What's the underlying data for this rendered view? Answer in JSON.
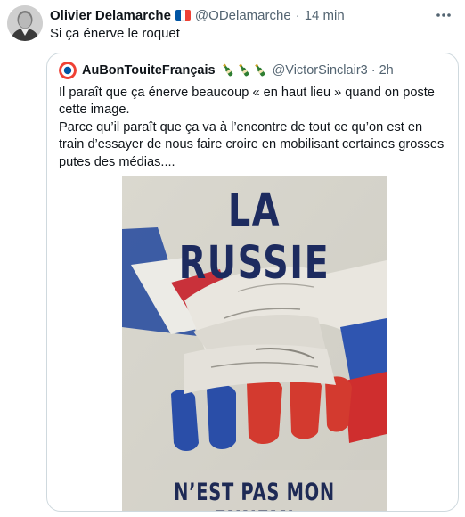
{
  "tweet": {
    "author_name": "Olivier Delamarche",
    "handle": "@ODelamarche",
    "separator": "·",
    "time": "14 min",
    "text": "Si ça énerve le roquet",
    "more_icon": "more-horizontal-icon"
  },
  "quoted_tweet": {
    "author_name": "AuBonTouiteFrançais",
    "name_emoji": "champagne-bottle-icon x3",
    "handle": "@VictorSinclair3",
    "separator": "·",
    "time": "2h",
    "paragraphs": [
      "Il paraît que ça énerve beaucoup « en haut lieu » quand on poste cette image.",
      "Parce qu’il paraît que ça va à l’encontre de tout ce qu’on est en train d’essayer de nous faire croire en mobilisant certaines grosses putes des médias...."
    ],
    "image": {
      "title": "LA RUSSIE",
      "subtitle": "N’EST PAS MON ENNEMI"
    }
  },
  "colors": {
    "text_primary": "#0f1419",
    "text_secondary": "#536471",
    "border": "#cfd9de",
    "poster_navy": "#1d2b5f",
    "flag_blue": "#0055a4",
    "flag_red": "#ef4135",
    "russia_blue": "#0039a6",
    "russia_red": "#d52b1e"
  }
}
